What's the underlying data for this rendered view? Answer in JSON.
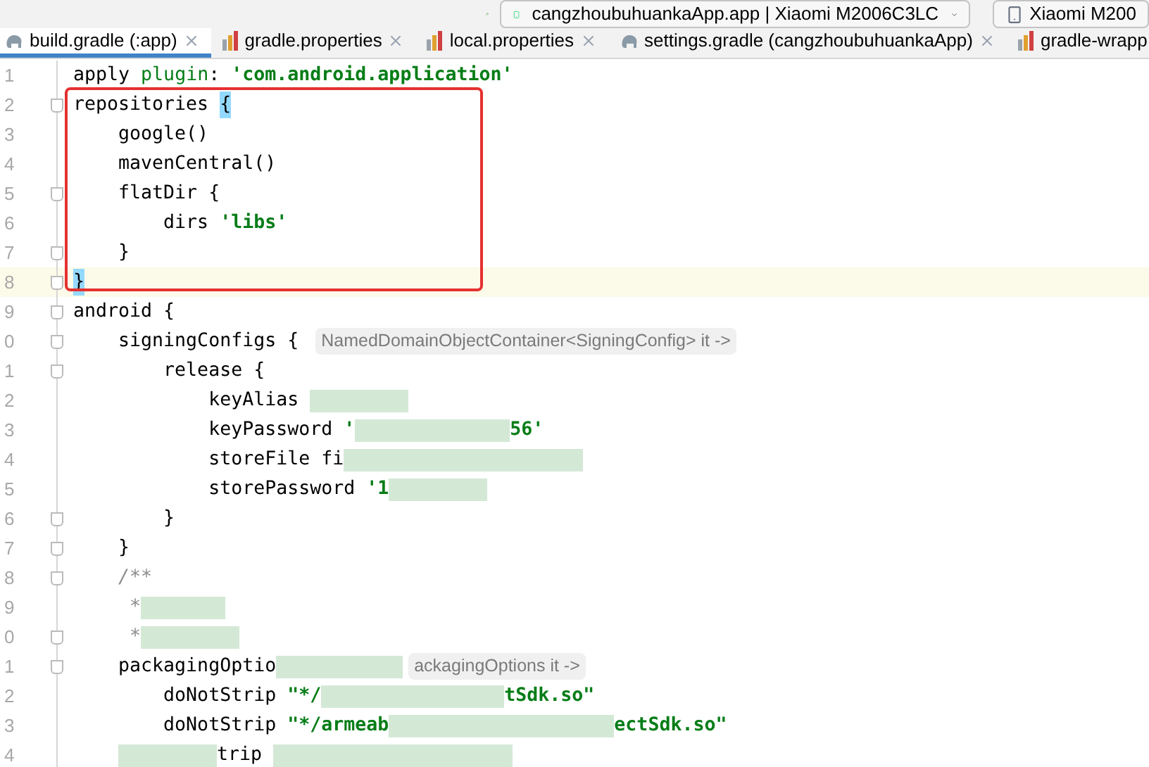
{
  "toolbar": {
    "run_config": "cangzhoubuhuankaApp.app | Xiaomi M2006C3LC",
    "device": "Xiaomi M200"
  },
  "tabs": [
    {
      "label": "build.gradle (:app)",
      "kind": "gradle",
      "selected": true
    },
    {
      "label": "gradle.properties",
      "kind": "properties",
      "selected": false
    },
    {
      "label": "local.properties",
      "kind": "properties",
      "selected": false
    },
    {
      "label": "settings.gradle (cangzhoubuhuankaApp)",
      "kind": "gradle",
      "selected": false
    },
    {
      "label": "gradle-wrapp",
      "kind": "properties",
      "selected": false
    }
  ],
  "editor": {
    "lines": [
      {
        "number": "1",
        "fold": false,
        "current": false,
        "segments": [
          {
            "kind": "plain",
            "text": "apply "
          },
          {
            "kind": "keyword",
            "text": "plugin"
          },
          {
            "kind": "plain",
            "text": ": "
          },
          {
            "kind": "string",
            "text": "'com.android.application'"
          }
        ]
      },
      {
        "number": "2",
        "fold": true,
        "current": false,
        "segments": [
          {
            "kind": "plain",
            "text": "repositories "
          },
          {
            "kind": "brace",
            "text": "{"
          }
        ]
      },
      {
        "number": "3",
        "fold": false,
        "current": false,
        "segments": [
          {
            "kind": "plain",
            "text": "    google()"
          }
        ]
      },
      {
        "number": "4",
        "fold": false,
        "current": false,
        "segments": [
          {
            "kind": "plain",
            "text": "    mavenCentral()"
          }
        ]
      },
      {
        "number": "5",
        "fold": true,
        "current": false,
        "segments": [
          {
            "kind": "plain",
            "text": "    flatDir {"
          }
        ]
      },
      {
        "number": "6",
        "fold": false,
        "current": false,
        "segments": [
          {
            "kind": "plain",
            "text": "        dirs "
          },
          {
            "kind": "string",
            "text": "'libs'"
          }
        ]
      },
      {
        "number": "7",
        "fold": true,
        "current": false,
        "segments": [
          {
            "kind": "plain",
            "text": "    }"
          }
        ]
      },
      {
        "number": "8",
        "fold": true,
        "current": true,
        "segments": [
          {
            "kind": "brace",
            "text": "}"
          }
        ]
      },
      {
        "number": "9",
        "fold": true,
        "current": false,
        "segments": [
          {
            "kind": "plain",
            "text": "android {"
          }
        ]
      },
      {
        "number": "0",
        "fold": true,
        "current": false,
        "segments": [
          {
            "kind": "plain",
            "text": "    signingConfigs { "
          },
          {
            "kind": "hint",
            "text": "NamedDomainObjectContainer<SigningConfig> it ->"
          }
        ]
      },
      {
        "number": "1",
        "fold": true,
        "current": false,
        "segments": [
          {
            "kind": "plain",
            "text": "        release {"
          }
        ]
      },
      {
        "number": "2",
        "fold": false,
        "current": false,
        "segments": [
          {
            "kind": "plain",
            "text": "            keyAlias "
          },
          {
            "kind": "redacted"
          }
        ]
      },
      {
        "number": "3",
        "fold": false,
        "current": false,
        "segments": [
          {
            "kind": "plain",
            "text": "            keyPassword "
          },
          {
            "kind": "string",
            "text": "'"
          },
          {
            "kind": "redacted"
          },
          {
            "kind": "string",
            "text": "56'"
          }
        ]
      },
      {
        "number": "4",
        "fold": false,
        "current": false,
        "segments": [
          {
            "kind": "plain",
            "text": "            storeFile fi"
          },
          {
            "kind": "redacted"
          },
          {
            "kind": "redacted"
          }
        ]
      },
      {
        "number": "5",
        "fold": false,
        "current": false,
        "segments": [
          {
            "kind": "plain",
            "text": "            storePassword "
          },
          {
            "kind": "string",
            "text": "'1"
          },
          {
            "kind": "redacted"
          }
        ]
      },
      {
        "number": "6",
        "fold": true,
        "current": false,
        "segments": [
          {
            "kind": "plain",
            "text": "        }"
          }
        ]
      },
      {
        "number": "7",
        "fold": true,
        "current": false,
        "segments": [
          {
            "kind": "plain",
            "text": "    }"
          }
        ]
      },
      {
        "number": "8",
        "fold": true,
        "current": false,
        "segments": [
          {
            "kind": "comment",
            "text": "    /**"
          }
        ]
      },
      {
        "number": "9",
        "fold": false,
        "current": false,
        "segments": [
          {
            "kind": "comment",
            "text": "     *"
          },
          {
            "kind": "redacted"
          }
        ]
      },
      {
        "number": "0",
        "fold": true,
        "current": false,
        "segments": [
          {
            "kind": "comment",
            "text": "     *"
          },
          {
            "kind": "redacted"
          }
        ]
      },
      {
        "number": "1",
        "fold": true,
        "current": false,
        "segments": [
          {
            "kind": "plain",
            "text": "    packagingOptio"
          },
          {
            "kind": "redacted"
          },
          {
            "kind": "hint",
            "text": "ackagingOptions it ->"
          }
        ]
      },
      {
        "number": "2",
        "fold": false,
        "current": false,
        "segments": [
          {
            "kind": "plain",
            "text": "        doNotStrip "
          },
          {
            "kind": "string",
            "text": "\"*/"
          },
          {
            "kind": "redacted"
          },
          {
            "kind": "redacted"
          },
          {
            "kind": "string",
            "text": "tSdk.so\""
          }
        ]
      },
      {
        "number": "3",
        "fold": false,
        "current": false,
        "segments": [
          {
            "kind": "plain",
            "text": "        doNotStrip "
          },
          {
            "kind": "string",
            "text": "\"*/armeab"
          },
          {
            "kind": "redacted"
          },
          {
            "kind": "redacted"
          },
          {
            "kind": "string",
            "text": "ectSdk.so\""
          }
        ]
      },
      {
        "number": "4",
        "fold": false,
        "current": false,
        "segments": [
          {
            "kind": "indent"
          },
          {
            "kind": "redacted"
          },
          {
            "kind": "plain",
            "text": "trip "
          },
          {
            "kind": "redacted"
          },
          {
            "kind": "redacted"
          }
        ]
      }
    ]
  }
}
